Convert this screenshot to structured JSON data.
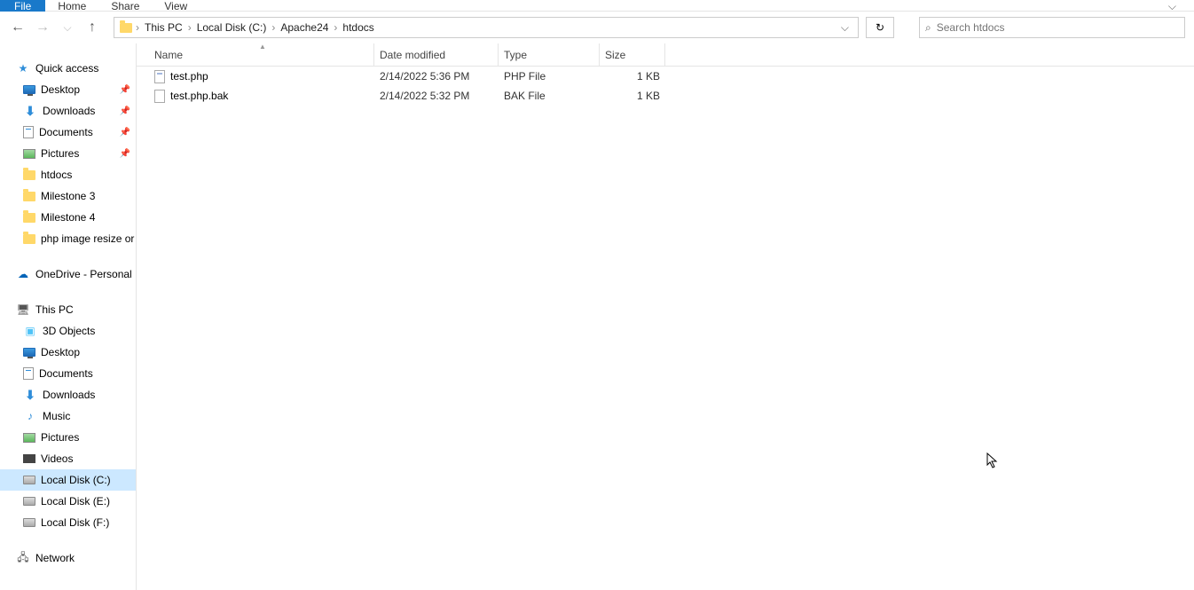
{
  "ribbon": {
    "tabs": [
      "File",
      "Home",
      "Share",
      "View"
    ]
  },
  "breadcrumbs": [
    "This PC",
    "Local Disk (C:)",
    "Apache24",
    "htdocs"
  ],
  "search": {
    "placeholder": "Search htdocs"
  },
  "tree": {
    "quick_access": "Quick access",
    "qa": [
      {
        "label": "Desktop",
        "pinned": true,
        "icon": "monitor"
      },
      {
        "label": "Downloads",
        "pinned": true,
        "icon": "down"
      },
      {
        "label": "Documents",
        "pinned": true,
        "icon": "doc"
      },
      {
        "label": "Pictures",
        "pinned": true,
        "icon": "pic"
      },
      {
        "label": "htdocs",
        "pinned": false,
        "icon": "folder"
      },
      {
        "label": "Milestone 3",
        "pinned": false,
        "icon": "folder"
      },
      {
        "label": "Milestone 4",
        "pinned": false,
        "icon": "folder"
      },
      {
        "label": "php image resize or",
        "pinned": false,
        "icon": "folder"
      }
    ],
    "onedrive": "OneDrive - Personal",
    "thispc": "This PC",
    "pc": [
      {
        "label": "3D Objects",
        "icon": "3d"
      },
      {
        "label": "Desktop",
        "icon": "monitor"
      },
      {
        "label": "Documents",
        "icon": "doc"
      },
      {
        "label": "Downloads",
        "icon": "down"
      },
      {
        "label": "Music",
        "icon": "music"
      },
      {
        "label": "Pictures",
        "icon": "pic"
      },
      {
        "label": "Videos",
        "icon": "video"
      },
      {
        "label": "Local Disk (C:)",
        "icon": "disk",
        "selected": true
      },
      {
        "label": "Local Disk (E:)",
        "icon": "disk"
      },
      {
        "label": "Local Disk (F:)",
        "icon": "disk"
      }
    ],
    "network": "Network"
  },
  "columns": {
    "name": "Name",
    "date": "Date modified",
    "type": "Type",
    "size": "Size"
  },
  "files": [
    {
      "name": "test.php",
      "date": "2/14/2022 5:36 PM",
      "type": "PHP File",
      "size": "1 KB",
      "icon": "php"
    },
    {
      "name": "test.php.bak",
      "date": "2/14/2022 5:32 PM",
      "type": "BAK File",
      "size": "1 KB",
      "icon": "file"
    }
  ]
}
